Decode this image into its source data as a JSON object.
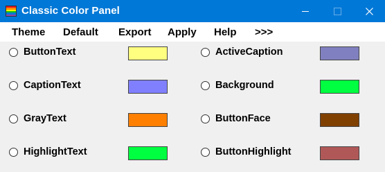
{
  "window": {
    "title": "Classic Color Panel",
    "icon": "rainbow-palette-icon",
    "icon_colors": [
      "#e81123",
      "#ff8c00",
      "#fff100",
      "#16c60c",
      "#0078d7",
      "#8e44ad"
    ],
    "controls": [
      "minimize-icon",
      "maximize-icon",
      "close-icon"
    ]
  },
  "menu": {
    "items": [
      {
        "label": "Theme"
      },
      {
        "label": "Default"
      },
      {
        "label": "Export"
      },
      {
        "label": "Apply"
      },
      {
        "label": "Help"
      },
      {
        "label": ">>>"
      }
    ]
  },
  "options": [
    {
      "label": "ButtonText",
      "color": "#ffff80",
      "selected": false
    },
    {
      "label": "CaptionText",
      "color": "#8080ff",
      "selected": false
    },
    {
      "label": "GrayText",
      "color": "#ff8000",
      "selected": false
    },
    {
      "label": "HighlightText",
      "color": "#00ff40",
      "selected": false
    },
    {
      "label": "ActiveCaption",
      "color": "#8080c0",
      "selected": false
    },
    {
      "label": "Background",
      "color": "#00ff40",
      "selected": false
    },
    {
      "label": "ButtonFace",
      "color": "#804000",
      "selected": false
    },
    {
      "label": "ButtonHighlight",
      "color": "#b05858",
      "selected": false
    }
  ],
  "theme": {
    "titlebar_color": "#0078d7",
    "menubar_color": "#ffffff",
    "panel_color": "#f0f0f0"
  }
}
